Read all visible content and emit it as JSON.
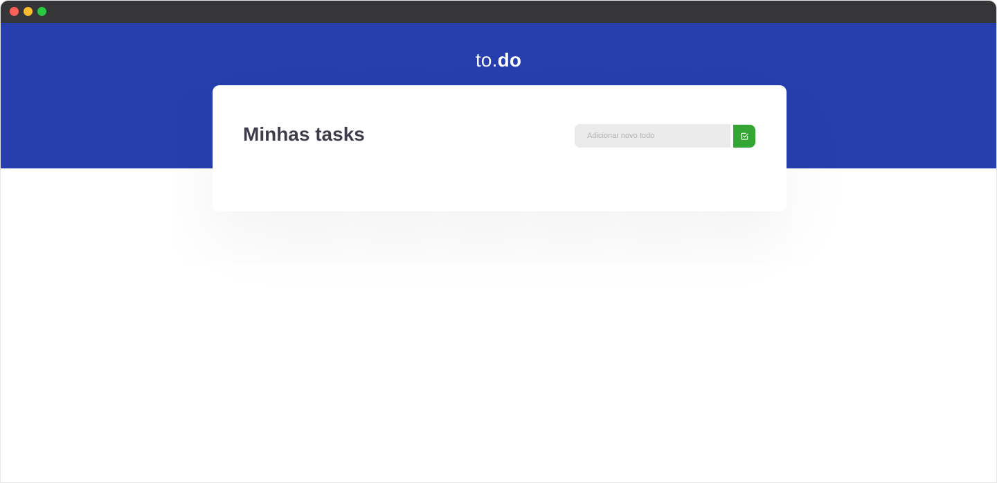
{
  "app": {
    "logo_light": "to.",
    "logo_bold": "do"
  },
  "card": {
    "title": "Minhas tasks",
    "input_placeholder": "Adicionar novo todo",
    "add_button_icon": "check-square-icon"
  },
  "colors": {
    "header_background": "#273fad",
    "add_button": "#33a633",
    "title_text": "#3d3d4d"
  }
}
